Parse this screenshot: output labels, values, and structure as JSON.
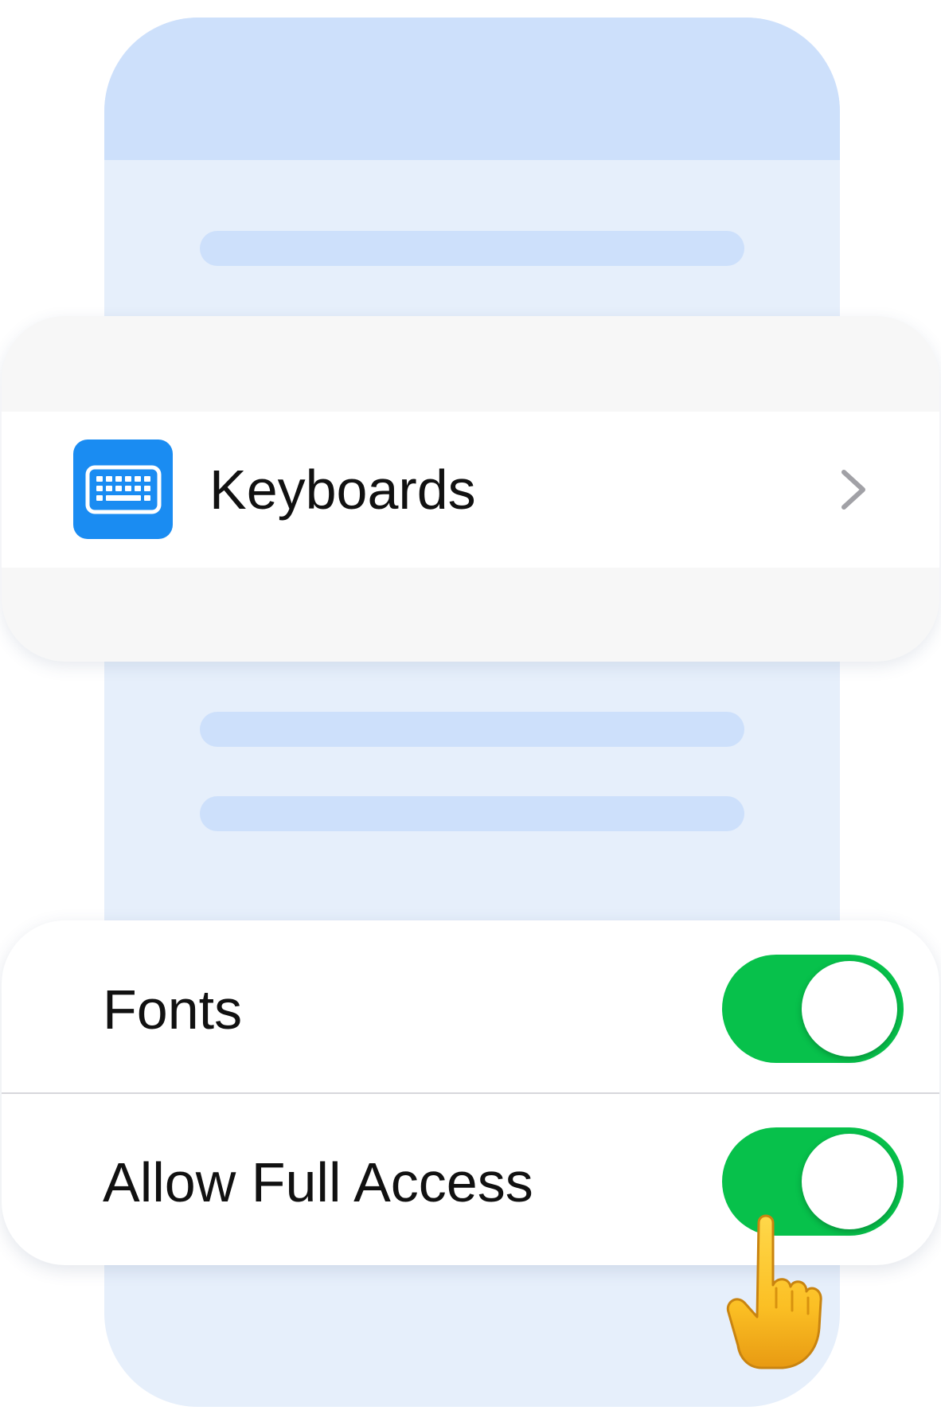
{
  "keyboards_card": {
    "label": "Keyboards",
    "icon": "keyboard-icon",
    "chevron_icon": "chevron-right-icon"
  },
  "toggles_card": {
    "items": [
      {
        "label": "Fonts",
        "state": "on"
      },
      {
        "label": "Allow Full Access",
        "state": "on"
      }
    ]
  },
  "colors": {
    "accent_blue": "#1a8cf2",
    "toggle_on": "#07c14b",
    "phone_background": "#e6effb",
    "phone_header": "#cde0fb"
  },
  "hand_icon": "pointing-hand-icon"
}
